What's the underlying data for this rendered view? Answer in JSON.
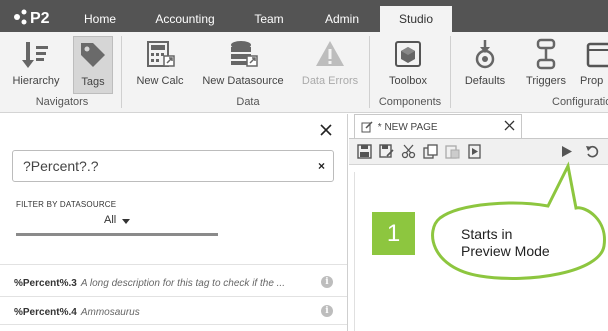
{
  "app": {
    "logo_text": "P2",
    "tabs": [
      {
        "label": "Home"
      },
      {
        "label": "Accounting"
      },
      {
        "label": "Team"
      },
      {
        "label": "Admin"
      },
      {
        "label": "Studio",
        "active": true
      }
    ]
  },
  "ribbon": {
    "buttons": [
      {
        "label": "Hierarchy",
        "icon": "hierarchy-icon"
      },
      {
        "label": "Tags",
        "icon": "tag-icon",
        "selected": true
      },
      {
        "label": "New Calc",
        "icon": "calculator-icon"
      },
      {
        "label": "New Datasource",
        "icon": "database-icon"
      },
      {
        "label": "Data Errors",
        "icon": "warning-icon",
        "disabled": true
      },
      {
        "label": "Toolbox",
        "icon": "toolbox-icon"
      },
      {
        "label": "Defaults",
        "icon": "defaults-icon"
      },
      {
        "label": "Triggers",
        "icon": "triggers-icon"
      },
      {
        "label": "Prop",
        "icon": "properties-icon"
      }
    ],
    "groups": [
      {
        "label": "Navigators"
      },
      {
        "label": "Data"
      },
      {
        "label": "Components"
      },
      {
        "label": "Configuratio"
      }
    ]
  },
  "tag_panel": {
    "search_value": "?Percent?.?",
    "clear_glyph": "×",
    "filter_label": "FILTER BY DATASOURCE",
    "filter_value": "All",
    "rows": [
      {
        "name": "%Percent%.3",
        "description": "A long description for this tag to check if the ..."
      },
      {
        "name": "%Percent%.4",
        "description": "Ammosaurus"
      }
    ]
  },
  "editor": {
    "tab_label": "* NEW PAGE",
    "badge_number": "1",
    "callout_line1": "Starts in",
    "callout_line2": "Preview Mode"
  },
  "colors": {
    "topbar": "#545454",
    "ribbon": "#f3f3f3",
    "badge": "#8dc63f",
    "callout_fill": "#ffffff",
    "callout_stroke": "#8dc63f"
  }
}
